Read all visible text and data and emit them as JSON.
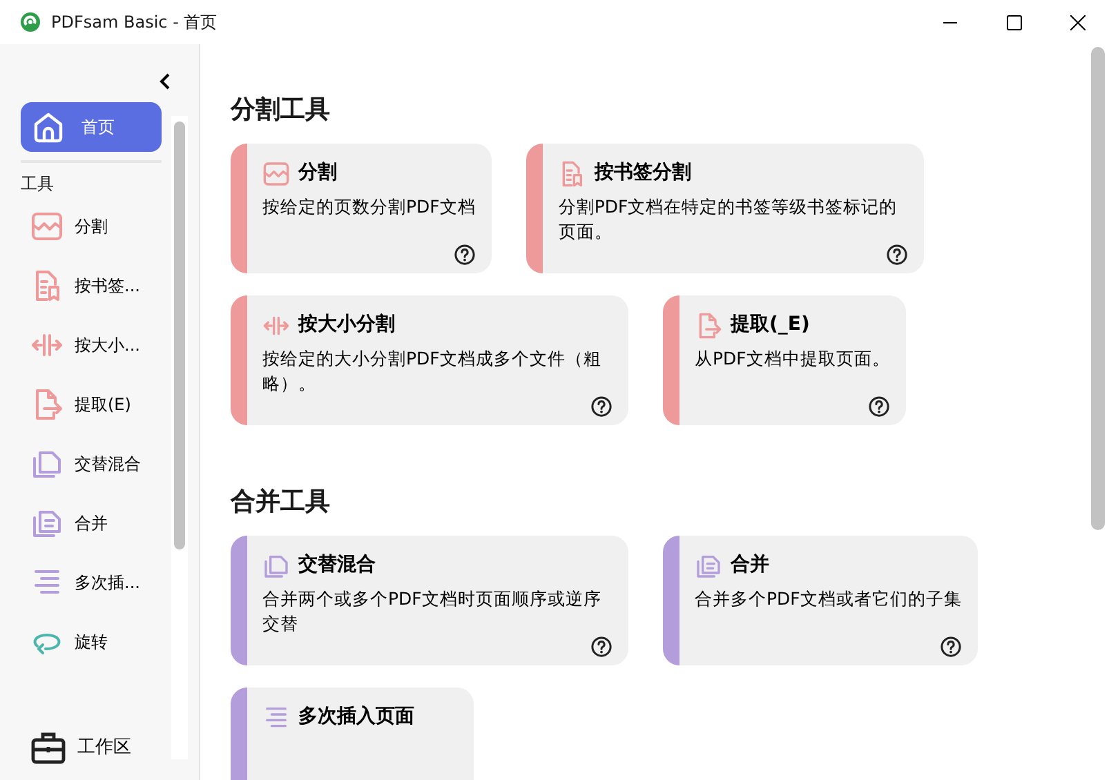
{
  "window": {
    "title": "PDFsam Basic - 首页"
  },
  "sidebar": {
    "home": {
      "label": "首页",
      "selected": true
    },
    "section_label": "工具",
    "items": [
      {
        "label": "分割",
        "color": "#ee9a9a",
        "selected": false
      },
      {
        "label": "按书签...",
        "color": "#ee9a9a",
        "selected": false
      },
      {
        "label": "按大小...",
        "color": "#ee9a9a",
        "selected": false
      },
      {
        "label": "提取(E)",
        "color": "#ee9a9a",
        "selected": false
      },
      {
        "label": "交替混合",
        "color": "#b39ddb",
        "selected": false
      },
      {
        "label": "合并",
        "color": "#b39ddb",
        "selected": false
      },
      {
        "label": "多次插...",
        "color": "#b39ddb",
        "selected": false
      },
      {
        "label": "旋转",
        "color": "#4db6ac",
        "selected": false
      }
    ],
    "workspace": {
      "label": "工作区",
      "selected": false
    }
  },
  "sections": [
    {
      "title": "分割工具",
      "color": "#ee9a9a",
      "cards": [
        {
          "title": "分割",
          "description": "按给定的页数分割PDF文档"
        },
        {
          "title": "按书签分割",
          "description": "分割PDF文档在特定的书签等级书签标记的页面。"
        },
        {
          "title": "按大小分割",
          "description": "按给定的大小分割PDF文档成多个文件（粗略）。"
        },
        {
          "title": "提取(_E)",
          "description": "从PDF文档中提取页面。"
        }
      ]
    },
    {
      "title": "合并工具",
      "color": "#b39ddb",
      "cards": [
        {
          "title": "交替混合",
          "description": "合并两个或多个PDF文档时页面顺序或逆序交替"
        },
        {
          "title": "合并",
          "description": "合并多个PDF文档或者它们的子集"
        },
        {
          "title": "多次插入页面"
        }
      ]
    }
  ]
}
